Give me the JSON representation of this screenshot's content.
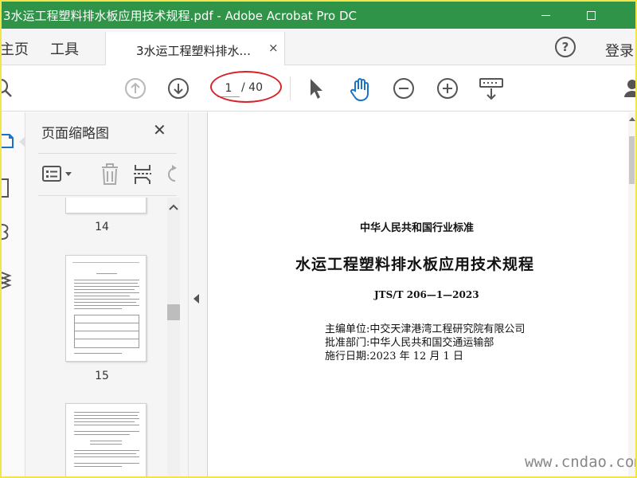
{
  "window": {
    "title": "3水运工程塑料排水板应用技术规程.pdf - Adobe Acrobat Pro DC"
  },
  "tabs": {
    "home": "主页",
    "tools": "工具",
    "document": "3水运工程塑料排水...",
    "close": "×",
    "help": "?",
    "login": "登录"
  },
  "toolbar": {
    "current_page": "1",
    "total_pages": "/ 40",
    "icons": [
      "prev-page-icon",
      "next-page-icon",
      "select-arrow-icon",
      "hand-tool-icon",
      "zoom-out-icon",
      "zoom-in-icon",
      "keyboard-icon"
    ]
  },
  "panel": {
    "title": "页面缩略图",
    "close": "✕",
    "thumbnails": [
      {
        "number": "14"
      },
      {
        "number": "15"
      }
    ]
  },
  "document": {
    "standard_type": "中华人民共和国行业标准",
    "standard_title": "水运工程塑料排水板应用技术规程",
    "standard_code": "JTS/T 206—1—2023",
    "lines": [
      "主编单位:中交天津港湾工程研究院有限公司",
      "批准部门:中华人民共和国交通运输部",
      "施行日期:2023 年 12 月 1 日"
    ]
  },
  "watermark": "www.cndao.com",
  "colors": {
    "titlebar": "#2f9348",
    "accent_blue": "#1a73c8",
    "annotation_red": "#d8232a",
    "frame": "#f2e44a"
  }
}
